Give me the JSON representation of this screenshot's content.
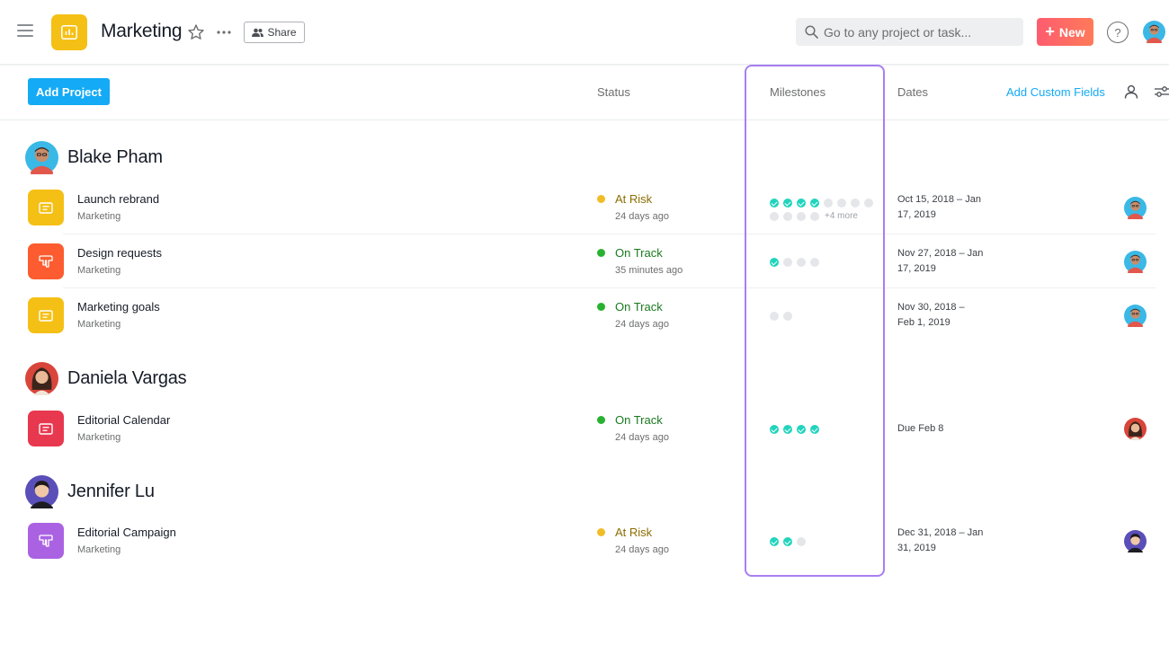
{
  "topbar": {
    "project_title": "Marketing",
    "share_label": "Share",
    "search_placeholder": "Go to any project or task...",
    "new_label": "New",
    "help_label": "?"
  },
  "columns": {
    "add_project_label": "Add Project",
    "status": "Status",
    "milestones": "Milestones",
    "dates": "Dates",
    "add_custom_fields": "Add Custom Fields"
  },
  "colors": {
    "accent_blue": "#14aaf5",
    "at_risk": "#f1bd26",
    "on_track": "#29b230",
    "milestone_done": "#22d4bd",
    "highlight": "#a87ff2"
  },
  "groups": [
    {
      "owner": "Blake Pham",
      "projects": [
        {
          "name": "Launch rebrand",
          "team": "Marketing",
          "icon": "list-icon",
          "color": "#f5c016",
          "status": "At Risk",
          "status_time": "24 days ago",
          "milestones_done": 4,
          "milestones_todo": 8,
          "milestones_more": "+4 more",
          "dates_line1": "Oct 15, 2018 – Jan",
          "dates_line2": "17, 2019"
        },
        {
          "name": "Design requests",
          "team": "Marketing",
          "icon": "board-icon",
          "color": "#fc5c2f",
          "status": "On Track",
          "status_time": "35 minutes ago",
          "milestones_done": 1,
          "milestones_todo": 3,
          "milestones_more": "",
          "dates_line1": "Nov 27, 2018 – Jan",
          "dates_line2": "17, 2019"
        },
        {
          "name": "Marketing goals",
          "team": "Marketing",
          "icon": "list-icon",
          "color": "#f5c016",
          "status": "On Track",
          "status_time": "24 days ago",
          "milestones_done": 0,
          "milestones_todo": 2,
          "milestones_more": "",
          "dates_line1": "Nov 30, 2018 –",
          "dates_line2": "Feb 1, 2019"
        }
      ]
    },
    {
      "owner": "Daniela Vargas",
      "projects": [
        {
          "name": "Editorial Calendar",
          "team": "Marketing",
          "icon": "list-icon",
          "color": "#e8384f",
          "status": "On Track",
          "status_time": "24 days ago",
          "milestones_done": 4,
          "milestones_todo": 0,
          "milestones_more": "",
          "dates_line1": "Due Feb 8",
          "dates_line2": ""
        }
      ]
    },
    {
      "owner": "Jennifer Lu",
      "projects": [
        {
          "name": "Editorial Campaign",
          "team": "Marketing",
          "icon": "board-icon",
          "color": "#aa62e3",
          "status": "At Risk",
          "status_time": "24 days ago",
          "milestones_done": 2,
          "milestones_todo": 1,
          "milestones_more": "",
          "dates_line1": "Dec 31, 2018 – Jan",
          "dates_line2": "31, 2019"
        }
      ]
    }
  ]
}
